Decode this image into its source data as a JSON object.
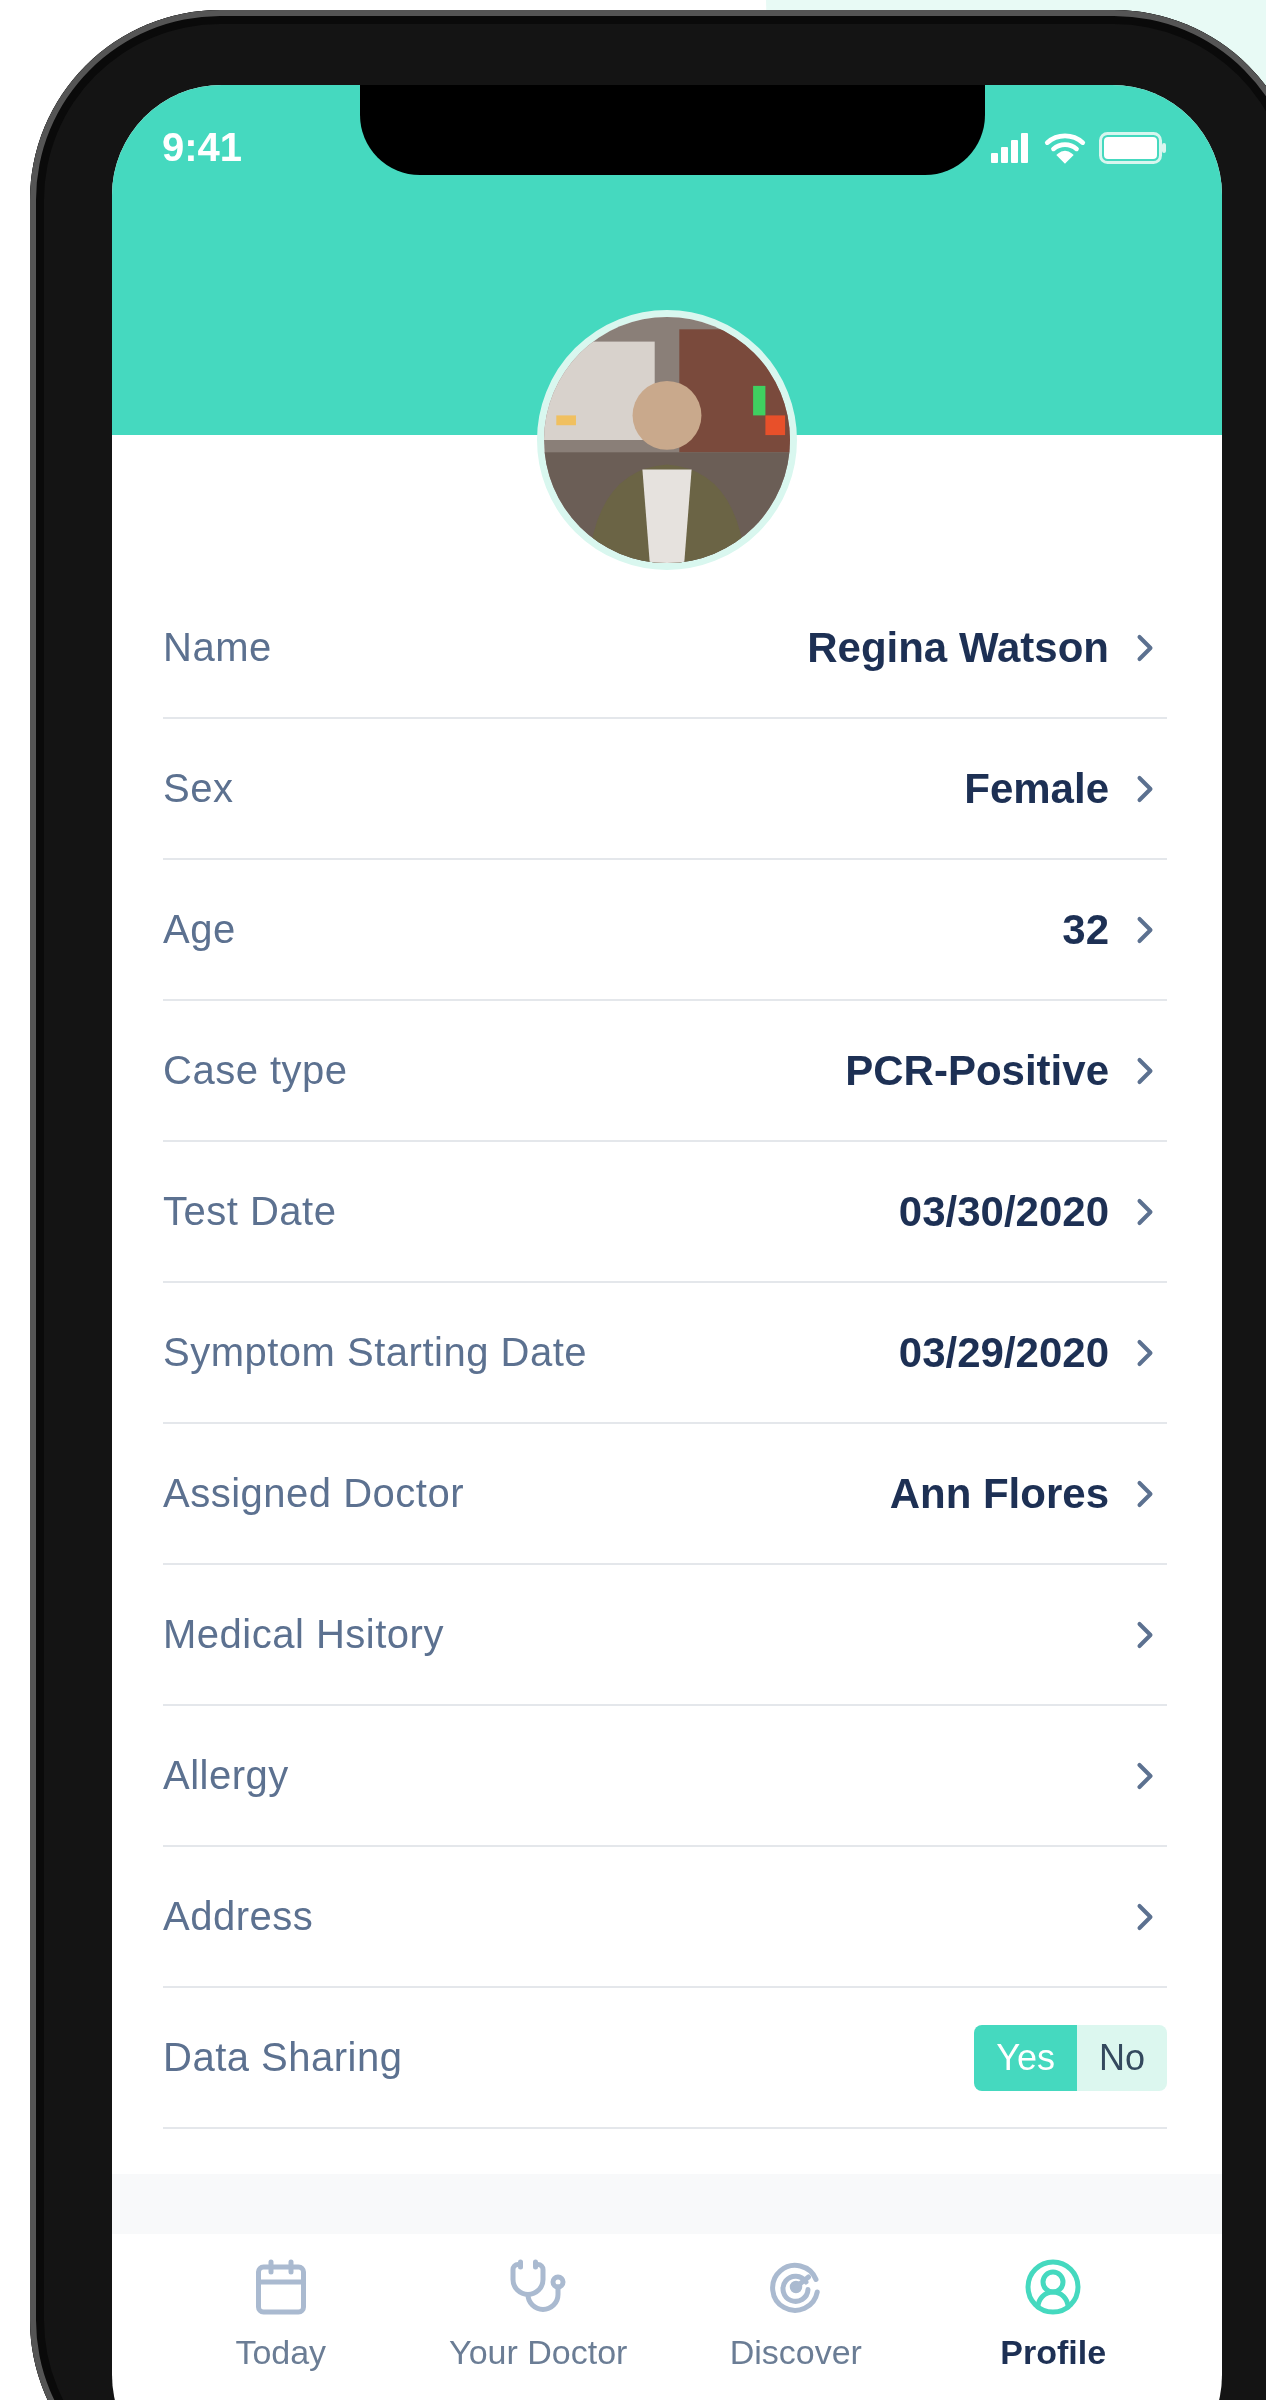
{
  "status_bar": {
    "time": "9:41"
  },
  "rows": [
    {
      "kind": "value",
      "label": "Name",
      "value": "Regina Watson"
    },
    {
      "kind": "value",
      "label": "Sex",
      "value": "Female"
    },
    {
      "kind": "value",
      "label": "Age",
      "value": "32"
    },
    {
      "kind": "value",
      "label": "Case type",
      "value": "PCR-Positive"
    },
    {
      "kind": "value",
      "label": "Test Date",
      "value": "03/30/2020"
    },
    {
      "kind": "value",
      "label": "Symptom Starting Date",
      "value": "03/29/2020"
    },
    {
      "kind": "value",
      "label": "Assigned Doctor",
      "value": "Ann Flores"
    },
    {
      "kind": "link",
      "label": "Medical Hsitory"
    },
    {
      "kind": "link",
      "label": "Allergy"
    },
    {
      "kind": "link",
      "label": "Address"
    },
    {
      "kind": "toggle",
      "label": "Data Sharing",
      "options": [
        {
          "label": "Yes",
          "selected": true
        },
        {
          "label": "No",
          "selected": false
        }
      ]
    }
  ],
  "tabs": [
    {
      "kind": "calendar",
      "label": "Today",
      "selected": false
    },
    {
      "kind": "doctor",
      "label": "Your Doctor",
      "selected": false
    },
    {
      "kind": "discover",
      "label": "Discover",
      "selected": false
    },
    {
      "kind": "profile",
      "label": "Profile",
      "selected": true
    }
  ]
}
